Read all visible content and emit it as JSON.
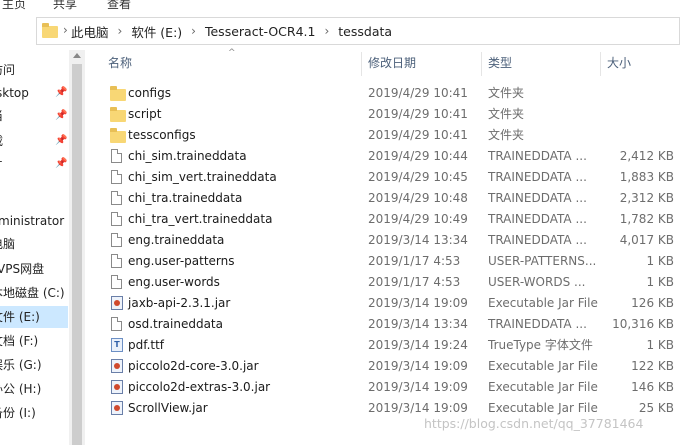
{
  "ribbon": {
    "tabs": [
      "主页",
      "共享",
      "查看"
    ]
  },
  "address": {
    "crumbs": [
      "此电脑",
      "软件 (E:)",
      "Tesseract-OCR4.1",
      "tessdata"
    ],
    "separator": "›"
  },
  "sidebar": {
    "items": [
      {
        "label": "访问",
        "pinned": false,
        "selected": false
      },
      {
        "label": "sktop",
        "pinned": true,
        "selected": false
      },
      {
        "label": "当",
        "pinned": true,
        "selected": false
      },
      {
        "label": "载",
        "pinned": true,
        "selected": false
      },
      {
        "label": "片",
        "pinned": true,
        "selected": false
      },
      {
        "label": "ministrator",
        "pinned": false,
        "selected": false
      },
      {
        "label": "电脑",
        "pinned": false,
        "selected": false
      },
      {
        "label": "VPS网盘",
        "pinned": false,
        "selected": false
      },
      {
        "label": "本地磁盘 (C:)",
        "pinned": false,
        "selected": false
      },
      {
        "label": "文件 (E:)",
        "pinned": false,
        "selected": true
      },
      {
        "label": "文档 (F:)",
        "pinned": false,
        "selected": false
      },
      {
        "label": "娱乐 (G:)",
        "pinned": false,
        "selected": false
      },
      {
        "label": "办公 (H:)",
        "pinned": false,
        "selected": false
      },
      {
        "label": "备份 (I:)",
        "pinned": false,
        "selected": false
      }
    ]
  },
  "columns": {
    "name": "名称",
    "date": "修改日期",
    "type": "类型",
    "size": "大小"
  },
  "files": [
    {
      "name": "configs",
      "date": "2019/4/29 10:41",
      "type": "文件夹",
      "size": "",
      "icon": "folder-icon"
    },
    {
      "name": "script",
      "date": "2019/4/29 10:41",
      "type": "文件夹",
      "size": "",
      "icon": "folder-icon"
    },
    {
      "name": "tessconfigs",
      "date": "2019/4/29 10:41",
      "type": "文件夹",
      "size": "",
      "icon": "folder-icon"
    },
    {
      "name": "chi_sim.traineddata",
      "date": "2019/4/29 10:44",
      "type": "TRAINEDDATA ...",
      "size": "2,412 KB",
      "icon": "file-icon"
    },
    {
      "name": "chi_sim_vert.traineddata",
      "date": "2019/4/29 10:45",
      "type": "TRAINEDDATA ...",
      "size": "1,883 KB",
      "icon": "file-icon"
    },
    {
      "name": "chi_tra.traineddata",
      "date": "2019/4/29 10:48",
      "type": "TRAINEDDATA ...",
      "size": "2,312 KB",
      "icon": "file-icon"
    },
    {
      "name": "chi_tra_vert.traineddata",
      "date": "2019/4/29 10:49",
      "type": "TRAINEDDATA ...",
      "size": "1,782 KB",
      "icon": "file-icon"
    },
    {
      "name": "eng.traineddata",
      "date": "2019/3/14 13:34",
      "type": "TRAINEDDATA ...",
      "size": "4,017 KB",
      "icon": "file-icon"
    },
    {
      "name": "eng.user-patterns",
      "date": "2019/1/17 4:53",
      "type": "USER-PATTERNS...",
      "size": "1 KB",
      "icon": "file-icon"
    },
    {
      "name": "eng.user-words",
      "date": "2019/1/17 4:53",
      "type": "USER-WORDS ...",
      "size": "1 KB",
      "icon": "file-icon"
    },
    {
      "name": "jaxb-api-2.3.1.jar",
      "date": "2019/3/14 19:09",
      "type": "Executable Jar File",
      "size": "126 KB",
      "icon": "jar-icon"
    },
    {
      "name": "osd.traineddata",
      "date": "2019/3/14 13:34",
      "type": "TRAINEDDATA ...",
      "size": "10,316 KB",
      "icon": "file-icon"
    },
    {
      "name": "pdf.ttf",
      "date": "2019/3/14 19:24",
      "type": "TrueType 字体文件",
      "size": "1 KB",
      "icon": "font-file-icon"
    },
    {
      "name": "piccolo2d-core-3.0.jar",
      "date": "2019/3/14 19:09",
      "type": "Executable Jar File",
      "size": "122 KB",
      "icon": "jar-icon"
    },
    {
      "name": "piccolo2d-extras-3.0.jar",
      "date": "2019/3/14 19:09",
      "type": "Executable Jar File",
      "size": "146 KB",
      "icon": "jar-icon"
    },
    {
      "name": "ScrollView.jar",
      "date": "2019/3/14 19:09",
      "type": "Executable Jar File",
      "size": "25 KB",
      "icon": "jar-icon"
    }
  ],
  "watermark": "https://blog.csdn.net/qq_37781464",
  "colors": {
    "selection": "#cce8ff",
    "folder": "#f8d775",
    "header_text": "#4c607a"
  }
}
